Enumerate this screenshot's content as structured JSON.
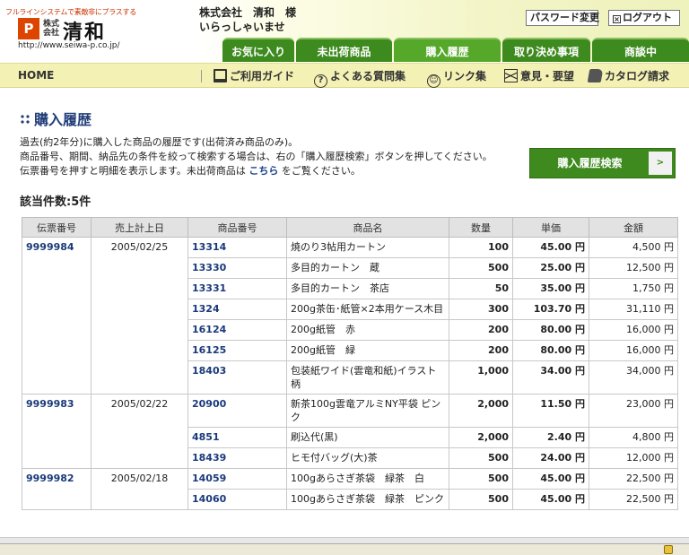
{
  "header": {
    "tagline": "フルラインシステムで素敵非にプラスする",
    "logo_mark": "P",
    "logo_kabu": "株式\n会社",
    "logo_name": "清和",
    "url": "http://www.seiwa-p.co.jp/",
    "welcome_line1": "株式会社　清和　様",
    "welcome_line2": "いらっしゃいませ",
    "password_button": "パスワード変更",
    "logout_button": "ログアウト"
  },
  "tabs": [
    {
      "label": "お気に入り"
    },
    {
      "label": "未出荷商品"
    },
    {
      "label": "購入履歴"
    },
    {
      "label": "取り決め事項"
    },
    {
      "label": "商談中"
    }
  ],
  "subnav": {
    "home": "HOME",
    "items": [
      {
        "label": "ご利用ガイド",
        "icon": "computer-icon"
      },
      {
        "label": "よくある質問集",
        "icon": "question-icon"
      },
      {
        "label": "リンク集",
        "icon": "smiley-icon"
      },
      {
        "label": "意見・要望",
        "icon": "mail-icon"
      },
      {
        "label": "カタログ請求",
        "icon": "catalog-icon"
      }
    ]
  },
  "main": {
    "title": "購入履歴",
    "desc_line1": "過去(約2年分)に購入した商品の履歴です(出荷済み商品のみ)。",
    "desc_line2": "商品番号、期間、納品先の条件を絞って検索する場合は、右の「購入履歴検索」ボタンを押してください。",
    "desc_line3_pre": "伝票番号を押すと明細を表示します。未出荷商品は ",
    "desc_link": "こちら",
    "desc_line3_post": " をご覧ください。",
    "search_button": "購入履歴検索",
    "search_arrow": ">",
    "count_label": "該当件数:5件"
  },
  "table": {
    "headers": [
      "伝票番号",
      "売上計上日",
      "商品番号",
      "商品名",
      "数量",
      "単価",
      "金額"
    ],
    "groups": [
      {
        "denpyo": "9999984",
        "date": "2005/02/25",
        "rows": [
          {
            "code": "13314",
            "name": "焼のり3帖用カートン",
            "qty": "100",
            "price": "45.00 円",
            "amount": "4,500 円"
          },
          {
            "code": "13330",
            "name": "多目的カートン　蔵",
            "qty": "500",
            "price": "25.00 円",
            "amount": "12,500 円"
          },
          {
            "code": "13331",
            "name": "多目的カートン　茶店",
            "qty": "50",
            "price": "35.00 円",
            "amount": "1,750 円"
          },
          {
            "code": "1324",
            "name": "200g茶缶･紙管×2本用ケース木目",
            "qty": "300",
            "price": "103.70 円",
            "amount": "31,110 円"
          },
          {
            "code": "16124",
            "name": "200g紙管　赤",
            "qty": "200",
            "price": "80.00 円",
            "amount": "16,000 円"
          },
          {
            "code": "16125",
            "name": "200g紙管　緑",
            "qty": "200",
            "price": "80.00 円",
            "amount": "16,000 円"
          },
          {
            "code": "18403",
            "name": "包装紙ワイド(雲竜和紙)イラスト柄",
            "qty": "1,000",
            "price": "34.00 円",
            "amount": "34,000 円"
          }
        ]
      },
      {
        "denpyo": "9999983",
        "date": "2005/02/22",
        "rows": [
          {
            "code": "20900",
            "name": "新茶100g雲竜アルミNY平袋 ピンク",
            "qty": "2,000",
            "price": "11.50 円",
            "amount": "23,000 円"
          },
          {
            "code": "4851",
            "name": "刷込代(黒)",
            "qty": "2,000",
            "price": "2.40 円",
            "amount": "4,800 円"
          },
          {
            "code": "18439",
            "name": "ヒモ付バッグ(大)茶",
            "qty": "500",
            "price": "24.00 円",
            "amount": "12,000 円"
          }
        ]
      },
      {
        "denpyo": "9999982",
        "date": "2005/02/18",
        "rows": [
          {
            "code": "14059",
            "name": "100gあらさぎ茶袋　緑茶　白",
            "qty": "500",
            "price": "45.00 円",
            "amount": "22,500 円"
          },
          {
            "code": "14060",
            "name": "100gあらさぎ茶袋　緑茶　ピンク",
            "qty": "500",
            "price": "45.00 円",
            "amount": "22,500 円"
          }
        ]
      }
    ]
  },
  "colors": {
    "tab_green": "#3d8a1e",
    "subnav_bg": "#f3f1b4",
    "title_blue": "#223f7a"
  }
}
